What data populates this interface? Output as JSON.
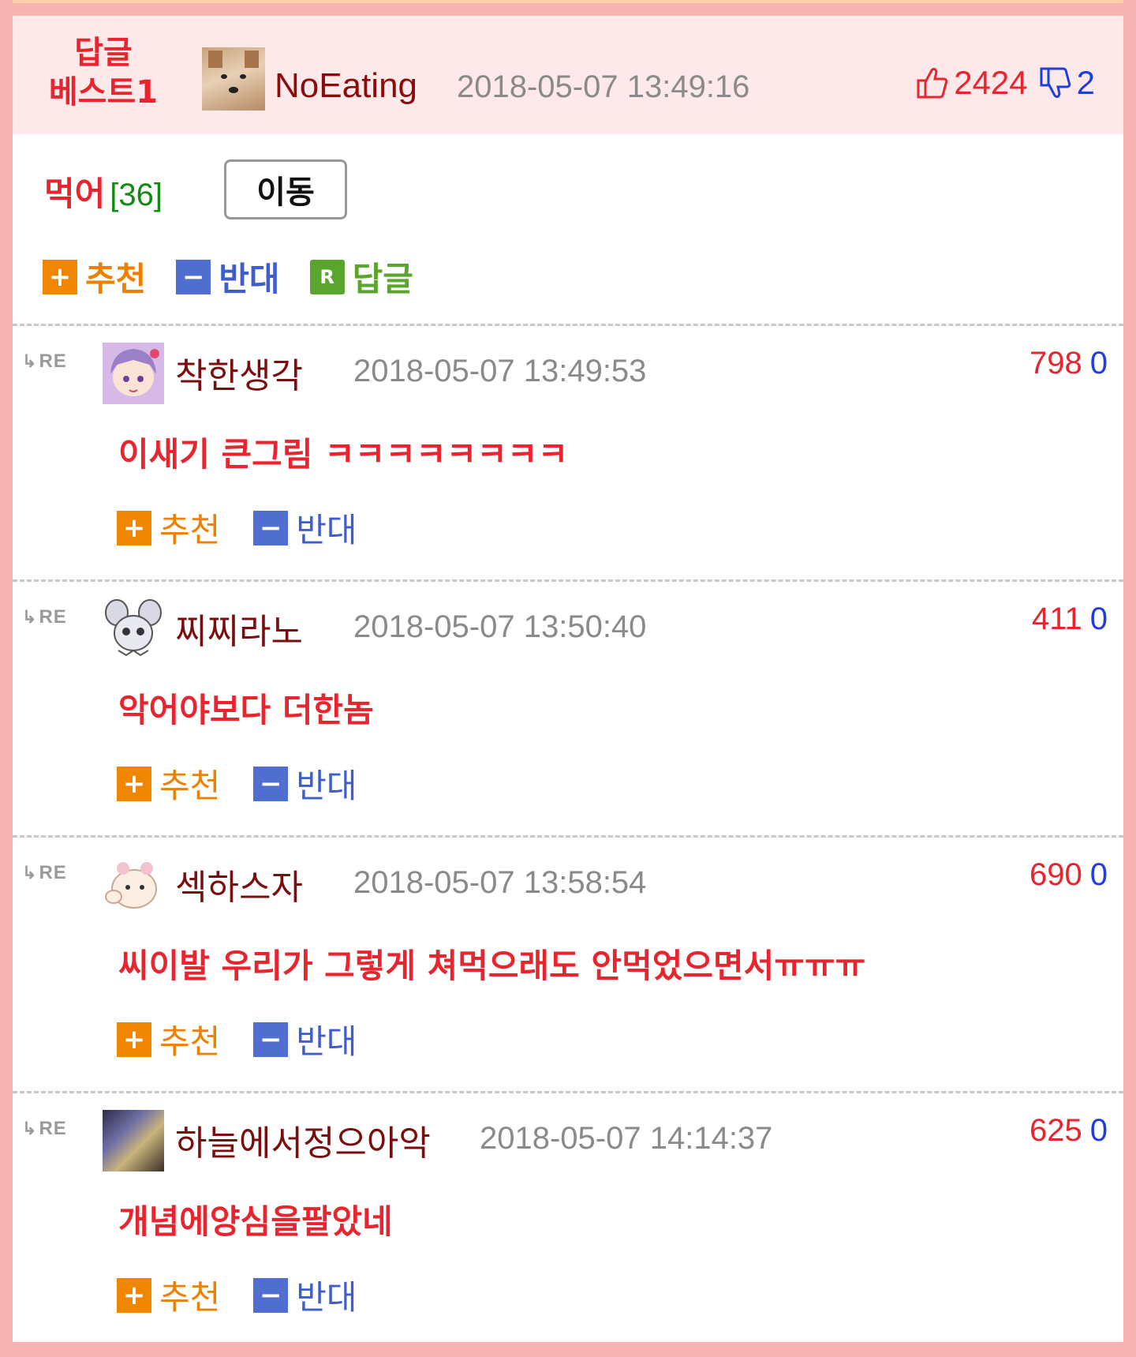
{
  "header": {
    "badge_line1": "답글",
    "badge_line2": "베스트1",
    "author": "NoEating",
    "date": "2018-05-07 13:49:16",
    "up_count": "2424",
    "down_count": "2",
    "up_icon": "thumbs-up-icon",
    "down_icon": "thumbs-down-icon"
  },
  "main_comment": {
    "text": "먹어",
    "count": "[36]",
    "move_label": "이동"
  },
  "actions": {
    "up_label": "추천",
    "down_label": "반대",
    "reply_label": "답글",
    "up_symbol": "+",
    "down_symbol": "−",
    "reply_symbol": "R"
  },
  "re_label": "RE",
  "replies": [
    {
      "author": "착한생각",
      "date": "2018-05-07 13:49:53",
      "up": "798",
      "down": "0",
      "text": "이새기 큰그림 ㅋㅋㅋㅋㅋㅋㅋㅋ"
    },
    {
      "author": "찌찌라노",
      "date": "2018-05-07 13:50:40",
      "up": "411",
      "down": "0",
      "text": "악어야보다 더한놈"
    },
    {
      "author": "섹하스자",
      "date": "2018-05-07 13:58:54",
      "up": "690",
      "down": "0",
      "text": "씨이발 우리가 그렇게 쳐먹으래도 안먹었으면서ㅠㅠㅠ"
    },
    {
      "author": "하늘에서정으아악",
      "date": "2018-05-07 14:14:37",
      "up": "625",
      "down": "0",
      "text": "개념에양심을팔았네"
    }
  ],
  "colors": {
    "page_border": "#f7b2b2",
    "header_bg": "#fde9e9",
    "accent_red": "#e8252f",
    "vote_blue": "#1f3ee0",
    "up_orange": "#f08500",
    "down_blue": "#4f6ecf",
    "reply_green": "#5aa52e"
  }
}
